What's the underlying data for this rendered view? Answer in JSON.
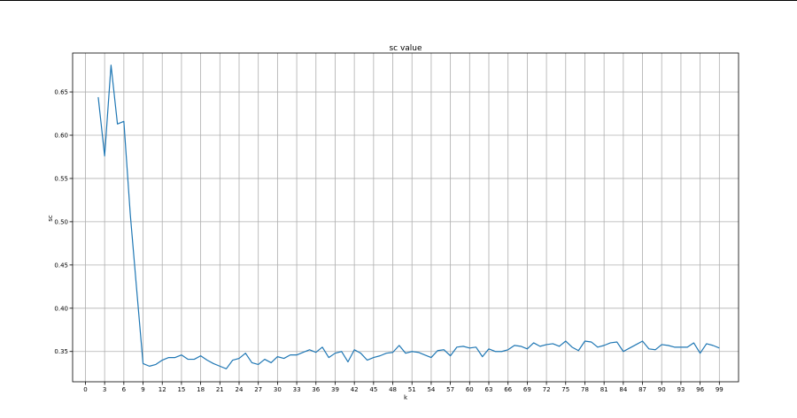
{
  "chart_data": {
    "type": "line",
    "title": "sc value",
    "xlabel": "k",
    "ylabel": "sc",
    "xlim": [
      -2,
      102
    ],
    "ylim": [
      0.315,
      0.695
    ],
    "grid": true,
    "x_major_ticks": [
      0,
      3,
      6,
      9,
      12,
      15,
      18,
      21,
      24,
      27,
      30,
      33,
      36,
      39,
      42,
      45,
      48,
      51,
      54,
      57,
      60,
      63,
      66,
      69,
      72,
      75,
      78,
      81,
      84,
      87,
      90,
      93,
      96,
      99
    ],
    "x_tick_labels": [
      "0",
      "3",
      "6",
      "9",
      "12",
      "15",
      "18",
      "21",
      "24",
      "27",
      "30",
      "33",
      "36",
      "39",
      "42",
      "45",
      "48",
      "51",
      "54",
      "57",
      "60",
      "63",
      "66",
      "69",
      "72",
      "75",
      "78",
      "81",
      "84",
      "87",
      "90",
      "93",
      "96",
      "99"
    ],
    "y_ticks": [
      0.35,
      0.4,
      0.45,
      0.5,
      0.55,
      0.6,
      0.65
    ],
    "y_tick_labels": [
      "0.35",
      "0.40",
      "0.45",
      "0.50",
      "0.55",
      "0.60",
      "0.65"
    ],
    "series": [
      {
        "color": "#1f77b4",
        "x": [
          2,
          3,
          4,
          5,
          6,
          7,
          8,
          9,
          10,
          11,
          12,
          13,
          14,
          15,
          16,
          17,
          18,
          19,
          20,
          21,
          22,
          23,
          24,
          25,
          26,
          27,
          28,
          29,
          30,
          31,
          32,
          33,
          34,
          35,
          36,
          37,
          38,
          39,
          40,
          41,
          42,
          43,
          44,
          45,
          46,
          47,
          48,
          49,
          50,
          51,
          52,
          53,
          54,
          55,
          56,
          57,
          58,
          59,
          60,
          61,
          62,
          63,
          64,
          65,
          66,
          67,
          68,
          69,
          70,
          71,
          72,
          73,
          74,
          75,
          76,
          77,
          78,
          79,
          80,
          81,
          82,
          83,
          84,
          85,
          86,
          87,
          88,
          89,
          90,
          91,
          92,
          93,
          94,
          95,
          96,
          97,
          98,
          99
        ],
        "values": [
          0.644,
          0.576,
          0.681,
          0.613,
          0.616,
          0.509,
          0.422,
          0.336,
          0.333,
          0.335,
          0.34,
          0.343,
          0.343,
          0.346,
          0.341,
          0.341,
          0.345,
          0.34,
          0.336,
          0.333,
          0.33,
          0.34,
          0.342,
          0.348,
          0.337,
          0.335,
          0.341,
          0.337,
          0.344,
          0.342,
          0.346,
          0.346,
          0.349,
          0.352,
          0.349,
          0.355,
          0.343,
          0.348,
          0.35,
          0.338,
          0.352,
          0.348,
          0.34,
          0.343,
          0.345,
          0.348,
          0.349,
          0.357,
          0.348,
          0.35,
          0.349,
          0.346,
          0.343,
          0.351,
          0.352,
          0.345,
          0.355,
          0.356,
          0.354,
          0.355,
          0.344,
          0.353,
          0.35,
          0.35,
          0.352,
          0.357,
          0.356,
          0.353,
          0.36,
          0.356,
          0.358,
          0.359,
          0.356,
          0.362,
          0.355,
          0.351,
          0.362,
          0.361,
          0.355,
          0.357,
          0.36,
          0.361,
          0.35,
          0.354,
          0.358,
          0.362,
          0.353,
          0.352,
          0.358,
          0.357,
          0.355,
          0.355,
          0.355,
          0.36,
          0.348,
          0.359,
          0.357,
          0.354
        ]
      }
    ]
  }
}
